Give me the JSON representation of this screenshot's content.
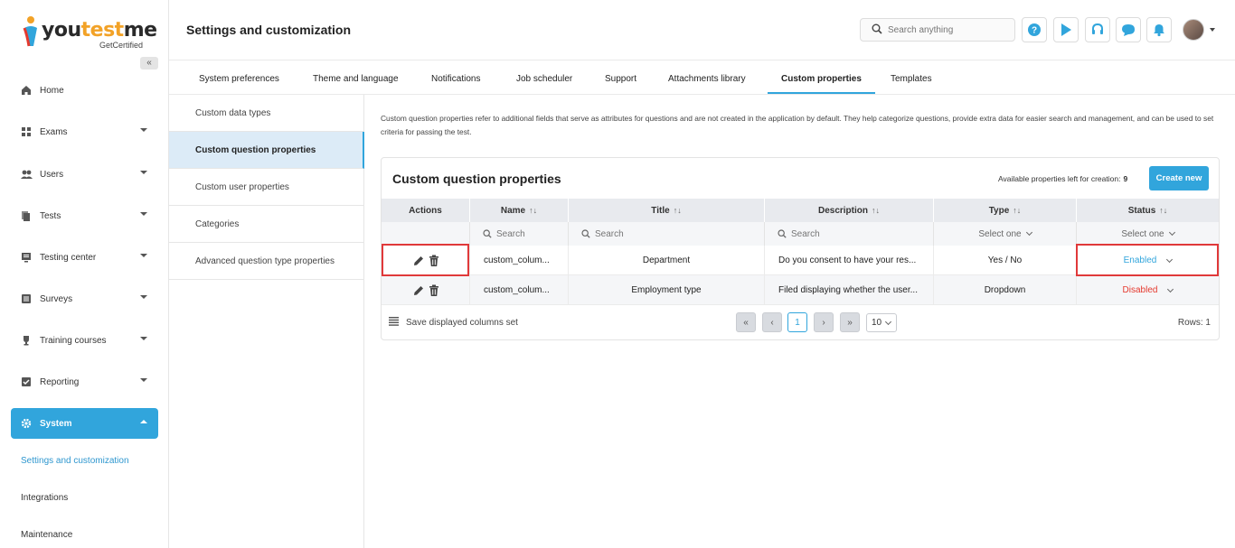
{
  "brand": {
    "name_part1": "you",
    "name_part2": "test",
    "name_part3": "me",
    "tagline": "GetCertified",
    "accent": "#31a5dc"
  },
  "sidebar": {
    "collapse_icon": "«",
    "items": [
      {
        "label": "Home",
        "icon": "home-icon"
      },
      {
        "label": "Exams",
        "icon": "exams-icon"
      },
      {
        "label": "Users",
        "icon": "users-icon"
      },
      {
        "label": "Tests",
        "icon": "tests-icon"
      },
      {
        "label": "Testing center",
        "icon": "testing-center-icon"
      },
      {
        "label": "Surveys",
        "icon": "surveys-icon"
      },
      {
        "label": "Training courses",
        "icon": "trophy-icon"
      },
      {
        "label": "Reporting",
        "icon": "reporting-icon"
      },
      {
        "label": "System",
        "icon": "gear-icon"
      }
    ],
    "sub_items": [
      "Settings and customization",
      "Integrations",
      "Maintenance"
    ]
  },
  "header": {
    "title": "Settings and customization",
    "search_placeholder": "Search anything"
  },
  "tabs": [
    "System preferences",
    "Theme and language",
    "Notifications",
    "Job scheduler",
    "Support",
    "Attachments library",
    "Custom properties",
    "Templates"
  ],
  "subnav": [
    "Custom data types",
    "Custom question properties",
    "Custom user properties",
    "Categories",
    "Advanced question type properties"
  ],
  "description": "Custom question properties refer to additional fields that serve as attributes for questions and are not created in the application by default. They help categorize questions, provide extra data for easier search and management, and can be used to set criteria for passing the test.",
  "card": {
    "title": "Custom question properties",
    "available_label": "Available properties left for creation:",
    "available_count": "9",
    "create_label": "Create new"
  },
  "table": {
    "columns": [
      "Actions",
      "Name",
      "Title",
      "Description",
      "Type",
      "Status"
    ],
    "sort_glyph": "↑↓",
    "search_placeholder": "Search",
    "select_placeholder": "Select one",
    "rows": [
      {
        "name": "custom_colum...",
        "title": "Department",
        "description": "Do you consent to have your res...",
        "type": "Yes / No",
        "status": "Enabled"
      },
      {
        "name": "custom_colum...",
        "title": "Employment type",
        "description": "Filed displaying whether the user...",
        "type": "Dropdown",
        "status": "Disabled"
      }
    ]
  },
  "footer": {
    "save_cols_label": "Save displayed columns set",
    "page": "1",
    "page_size": "10",
    "rows_label": "Rows: 1"
  }
}
